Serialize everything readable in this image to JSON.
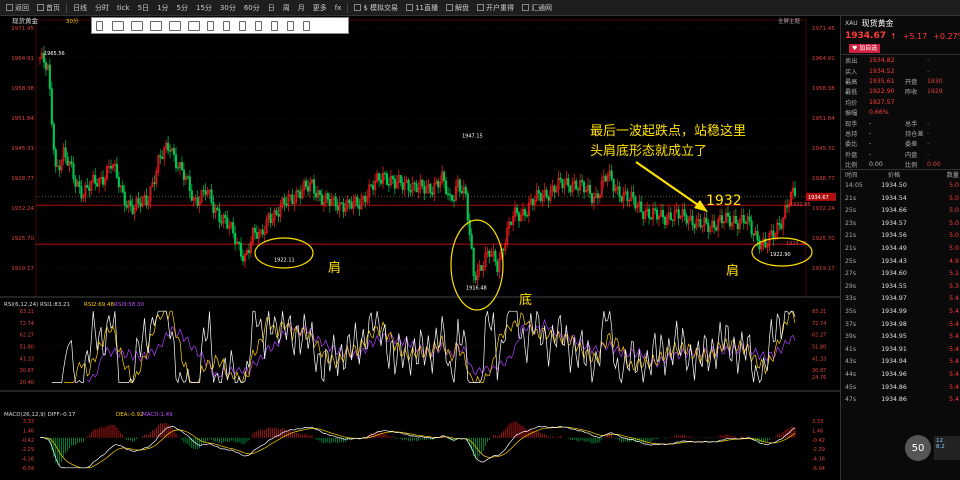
{
  "topbar": {
    "items": [
      "返回",
      "首页",
      "",
      "日线",
      "分时",
      "tick",
      "5日",
      "1分",
      "5分",
      "15分",
      "30分",
      "60分",
      "日",
      "周",
      "月",
      "更多",
      "fx",
      "",
      "$ 模拟交易",
      "11直播",
      "解盘",
      "开户重得",
      "汇通网"
    ]
  },
  "chart": {
    "instrument_label": "现货黄金",
    "instrument_tag": "30分",
    "layout_button": "全屏主题",
    "price_axis": [
      "1971.45",
      "1964.91",
      "1958.38",
      "1951.84",
      "1945.31",
      "1938.77",
      "1932.24",
      "1925.70",
      "1919.17"
    ],
    "labels": {
      "high_start": "1965.56",
      "high_mid": "1947.15",
      "low_left": "1922.11",
      "low_mid": "1916.48",
      "low_right": "1922.90",
      "last_price_tag": "1934.67",
      "right_tag2": "1932.86",
      "right_tag3": "1924.36"
    },
    "annotations": {
      "left_shoulder": "肩",
      "bottom": "底",
      "right_shoulder": "肩",
      "level": "1932",
      "note_line1": "最后一波起跌点，站稳这里",
      "note_line2": "头肩底形态就成立了"
    },
    "rsi": {
      "header": "RSI(6,12,24) RSI1:83.21",
      "rsi2": "RSI2:69.48",
      "rsi3": "RSI3:58.30",
      "axis": [
        "83.21",
        "72.74",
        "62.27",
        "51.80",
        "41.33",
        "30.87",
        "20.40"
      ],
      "right_axis": [
        "83.21",
        "72.74",
        "62.27",
        "51.80",
        "41.33",
        "30.87",
        "24.76"
      ]
    },
    "macd": {
      "header": "MACD(26,12,9) DIFF:-0.17",
      "dea": "DEA:-0.92",
      "macd": "MACD:1.49",
      "axis": [
        "3.33",
        "1.46",
        "-0.42",
        "-2.29",
        "-4.16",
        "-6.04"
      ]
    },
    "colors": {
      "up": "#ff2020",
      "down": "#00c853",
      "ma1": "#ffffff",
      "ma2": "#ffd000",
      "ma3": "#b040ff",
      "ellipse": "#ffe000",
      "level_line": "#d01010"
    }
  },
  "side": {
    "code": "XAU",
    "name": "现货黄金",
    "price": "1934.67",
    "arrow": "↑",
    "change": "+5.17",
    "pct": "+0.27%",
    "badge": "♥ 加自选",
    "quotes": [
      {
        "l": "卖出",
        "v": "1934.82",
        "l2": "",
        "v2": "-"
      },
      {
        "l": "买入",
        "v": "1934.52",
        "l2": "",
        "v2": "-"
      },
      {
        "l": "最高",
        "v": "1935.61",
        "l2": "开盘",
        "v2": "1930"
      },
      {
        "l": "最低",
        "v": "1922.90",
        "l2": "昨收",
        "v2": "1929"
      },
      {
        "l": "均价",
        "v": "1927.57",
        "l2": "",
        "v2": ""
      },
      {
        "l": "振幅",
        "v": "0.66%",
        "l2": "",
        "v2": ""
      },
      {
        "l": "现手",
        "v": "-",
        "l2": "总手",
        "v2": "-"
      },
      {
        "l": "总持",
        "v": "-",
        "l2": "持仓差",
        "v2": "-"
      },
      {
        "l": "委比",
        "v": "-",
        "l2": "委差",
        "v2": "-"
      },
      {
        "l": "外盘",
        "v": "-",
        "l2": "内盘",
        "v2": "-"
      },
      {
        "l": "比例",
        "v": "0.00",
        "l2": "比例",
        "v2": "0.00"
      }
    ],
    "tick_header": [
      "时间",
      "价格",
      "数量"
    ],
    "ticks": [
      {
        "t": "14:05",
        "p": "1934.50",
        "q": "5.0"
      },
      {
        "t": "21s",
        "p": "1934.54",
        "q": "5.0"
      },
      {
        "t": "25s",
        "p": "1934.66",
        "q": "5.0"
      },
      {
        "t": "23s",
        "p": "1934.57",
        "q": "5.0"
      },
      {
        "t": "21s",
        "p": "1934.56",
        "q": "5.0"
      },
      {
        "t": "21s",
        "p": "1934.49",
        "q": "5.0"
      },
      {
        "t": "25s",
        "p": "1934.43",
        "q": "4.9"
      },
      {
        "t": "27s",
        "p": "1934.60",
        "q": "5.1"
      },
      {
        "t": "29s",
        "p": "1934.55",
        "q": "5.3"
      },
      {
        "t": "33s",
        "p": "1934.97",
        "q": "5.4"
      },
      {
        "t": "35s",
        "p": "1934.99",
        "q": "5.4"
      },
      {
        "t": "37s",
        "p": "1934.98",
        "q": "5.4"
      },
      {
        "t": "39s",
        "p": "1934.95",
        "q": "5.4"
      },
      {
        "t": "41s",
        "p": "1934.91",
        "q": "5.4"
      },
      {
        "t": "43s",
        "p": "1934.94",
        "q": "5.4"
      },
      {
        "t": "44s",
        "p": "1934.96",
        "q": "5.4"
      },
      {
        "t": "45s",
        "p": "1934.86",
        "q": "5.4"
      },
      {
        "t": "47s",
        "p": "1934.86",
        "q": "5.4"
      }
    ],
    "floating_number": "50",
    "speed_up": "12",
    "speed_down": "8.2"
  }
}
